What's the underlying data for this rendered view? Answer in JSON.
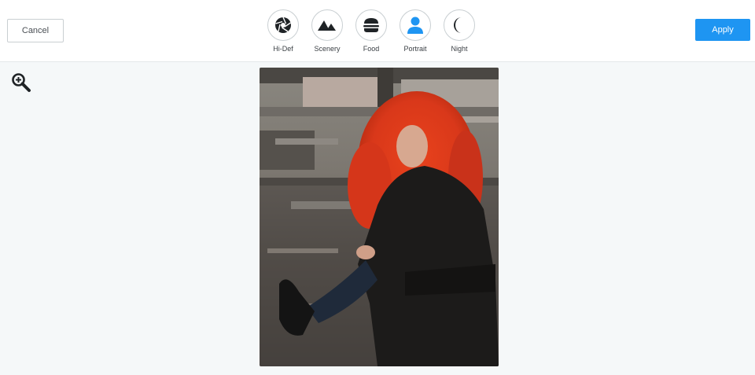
{
  "toolbar": {
    "cancel_label": "Cancel",
    "apply_label": "Apply",
    "accent_color": "#1e95f2"
  },
  "filters": [
    {
      "label": "Hi-Def",
      "icon": "aperture-icon"
    },
    {
      "label": "Scenery",
      "icon": "mountains-icon"
    },
    {
      "label": "Food",
      "icon": "burger-icon"
    },
    {
      "label": "Portrait",
      "icon": "person-icon",
      "active_color": "#1e95f2"
    },
    {
      "label": "Night",
      "icon": "crescent-moon-icon"
    }
  ],
  "canvas": {
    "zoom_icon": "zoom-in-icon"
  }
}
